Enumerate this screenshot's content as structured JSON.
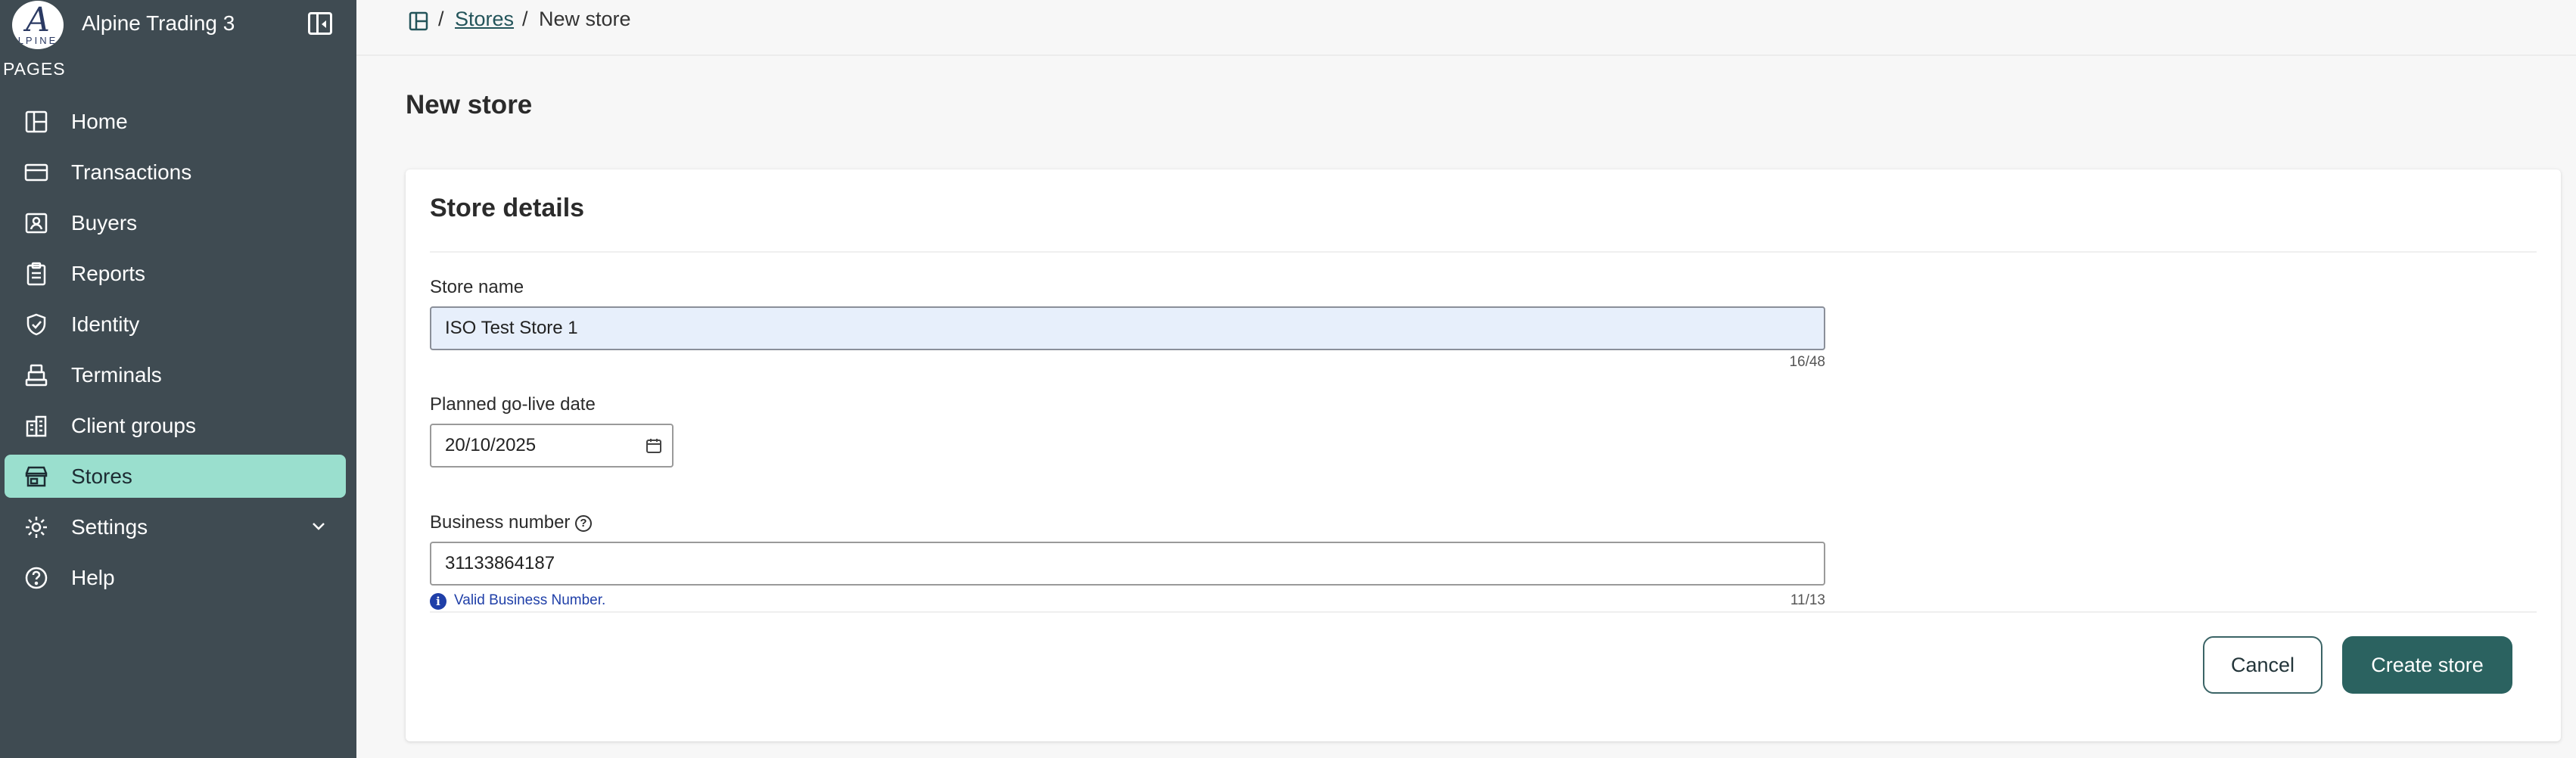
{
  "sidebar": {
    "brand_name": "Alpine Trading 3",
    "logo_letter": "A",
    "logo_word": "LPINE",
    "section_label": "PAGES",
    "items": [
      {
        "label": "Home",
        "icon": "home-icon"
      },
      {
        "label": "Transactions",
        "icon": "credit-card-icon"
      },
      {
        "label": "Buyers",
        "icon": "buyer-badge-icon"
      },
      {
        "label": "Reports",
        "icon": "clipboard-icon"
      },
      {
        "label": "Identity",
        "icon": "shield-check-icon"
      },
      {
        "label": "Terminals",
        "icon": "terminal-icon"
      },
      {
        "label": "Client groups",
        "icon": "building-icon"
      },
      {
        "label": "Stores",
        "icon": "store-icon",
        "active": true
      },
      {
        "label": "Settings",
        "icon": "gear-icon",
        "expandable": true
      },
      {
        "label": "Help",
        "icon": "help-circle-icon"
      }
    ]
  },
  "breadcrumb": {
    "separator": "/",
    "link": "Stores",
    "current": "New store"
  },
  "page": {
    "title": "New store"
  },
  "form": {
    "section_title": "Store details",
    "store_name": {
      "label": "Store name",
      "value": "ISO Test Store 1",
      "counter": "16/48"
    },
    "go_live": {
      "label": "Planned go-live date",
      "value": "20/10/2025"
    },
    "business_number": {
      "label": "Business number",
      "value": "31133864187",
      "hint_icon": "i",
      "hint": "Valid Business Number.",
      "counter": "11/13"
    },
    "cancel_label": "Cancel",
    "submit_label": "Create store"
  },
  "colors": {
    "sidebar_bg": "#3f4b52",
    "active_item_bg": "#9adfce",
    "primary_button": "#2b6260",
    "hint_text": "#1f3fa8"
  }
}
